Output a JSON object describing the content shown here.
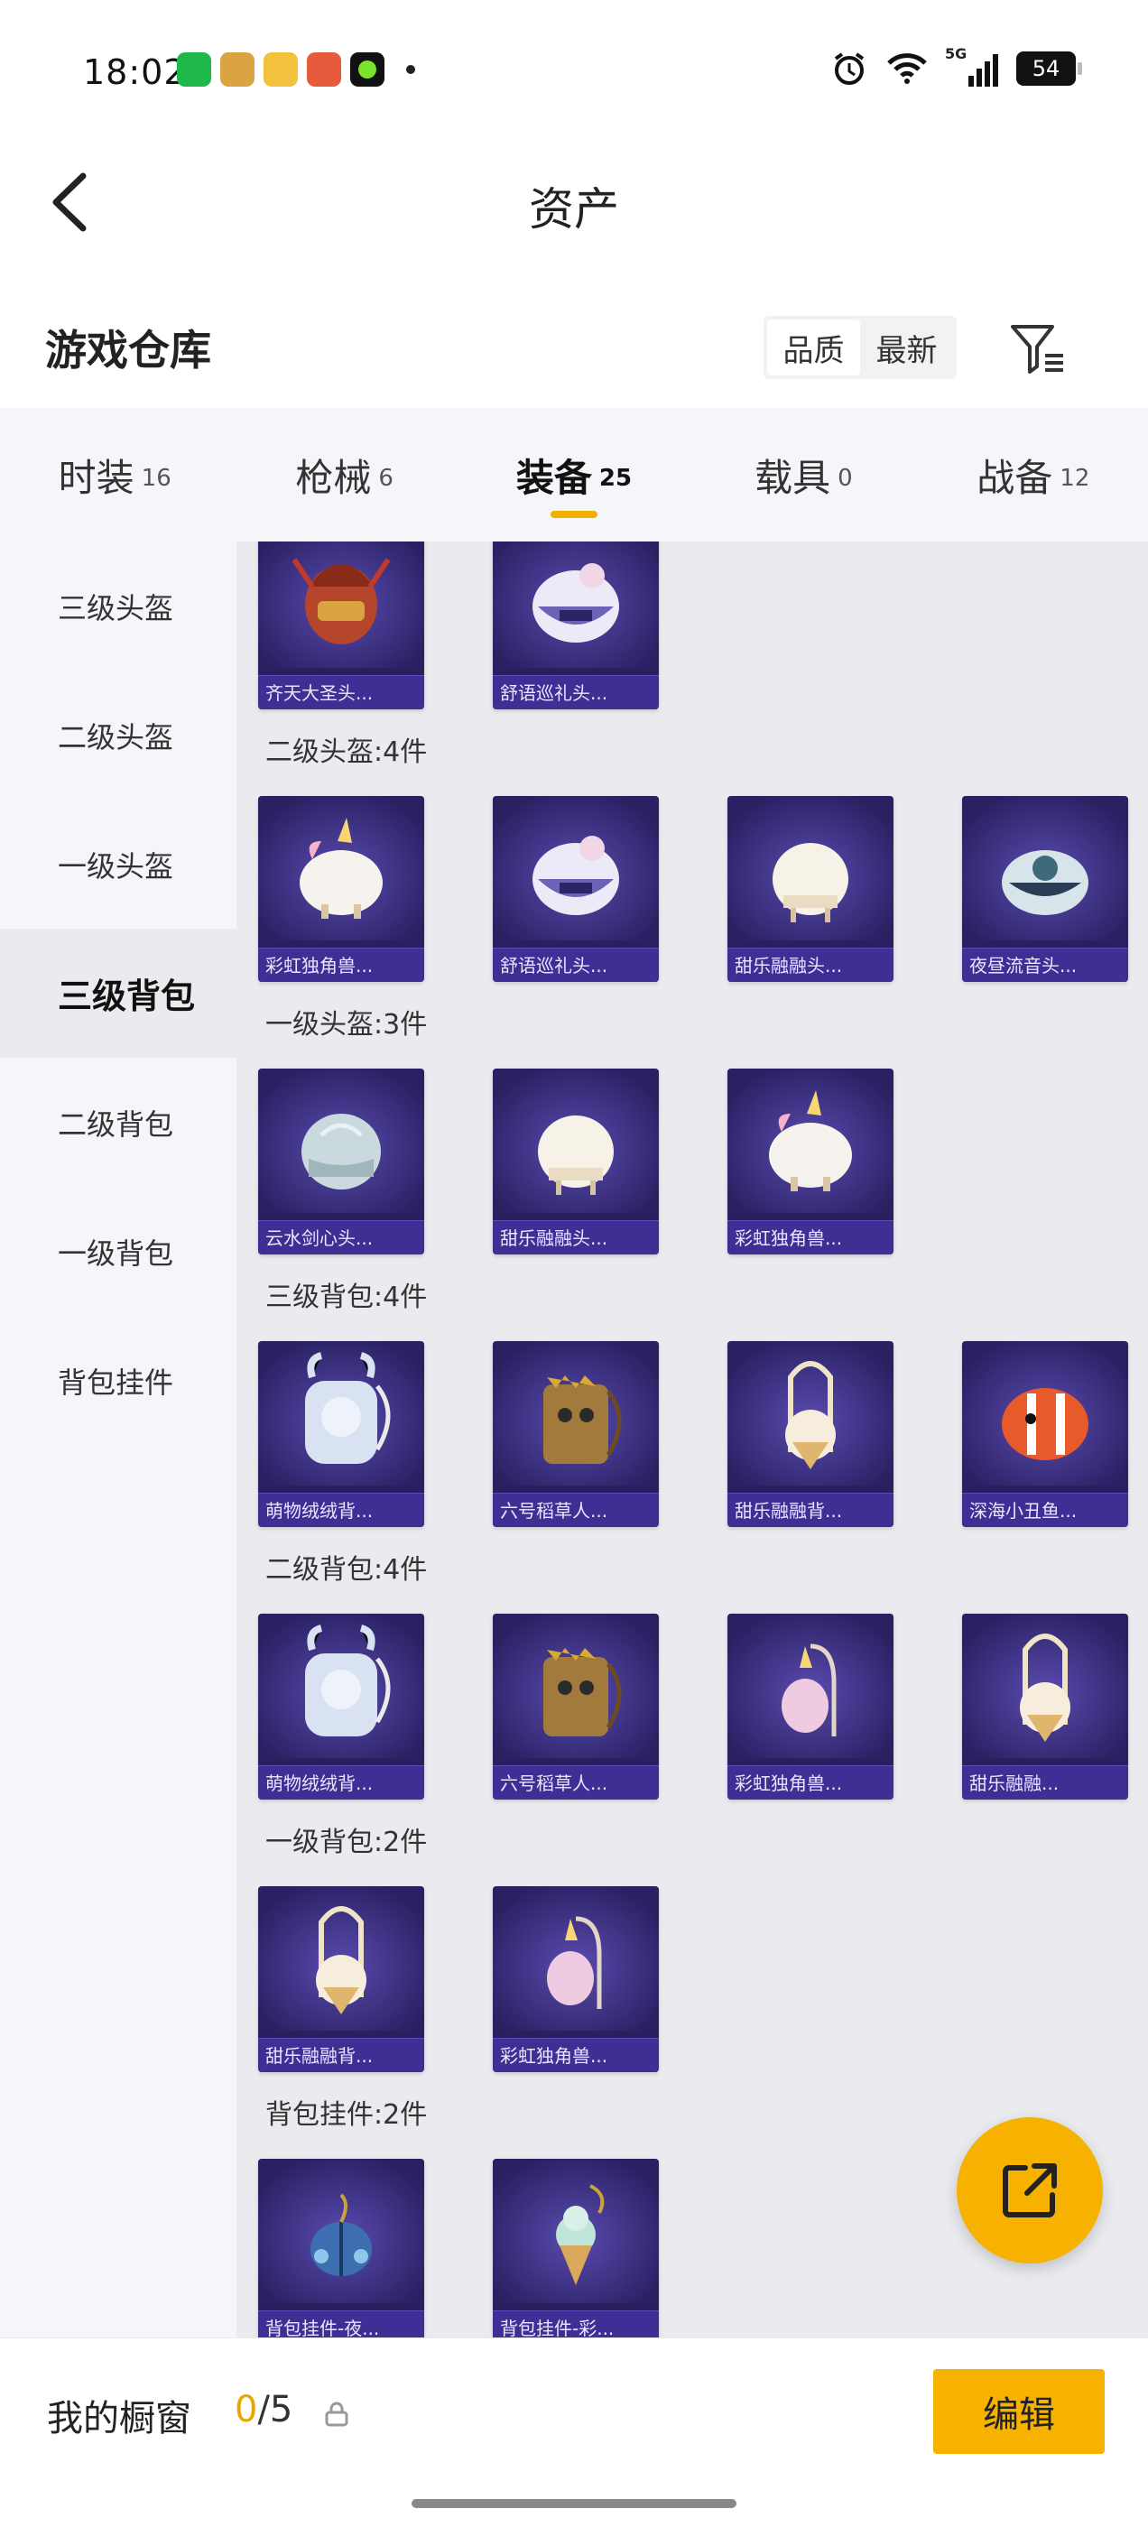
{
  "status_bar": {
    "time": "18:02",
    "app_colors": [
      "#1fb84a",
      "#d9a441",
      "#f2c23c",
      "#e55b3c",
      "#111111"
    ],
    "signal_text": "5G",
    "battery": "54"
  },
  "nav": {
    "title": "资产"
  },
  "section": {
    "title": "游戏仓库",
    "sort_options": [
      "品质",
      "最新"
    ],
    "active_sort": "品质"
  },
  "tabs": [
    {
      "label": "时装",
      "count": "16"
    },
    {
      "label": "枪械",
      "count": "6"
    },
    {
      "label": "装备",
      "count": "25"
    },
    {
      "label": "载具",
      "count": "0"
    },
    {
      "label": "战备",
      "count": "12"
    }
  ],
  "active_tab": "装备",
  "sidebar": [
    {
      "label": "三级头盔"
    },
    {
      "label": "二级头盔"
    },
    {
      "label": "一级头盔"
    },
    {
      "label": "三级背包"
    },
    {
      "label": "二级背包"
    },
    {
      "label": "一级背包"
    },
    {
      "label": "背包挂件"
    }
  ],
  "active_sidebar": "三级背包",
  "groups": [
    {
      "label": "",
      "items": [
        {
          "name": "齐天大圣头...",
          "icon": "helmet-monkey-king"
        },
        {
          "name": "舒语巡礼头...",
          "icon": "helmet-pilgrimage"
        }
      ]
    },
    {
      "label": "二级头盔:4件",
      "items": [
        {
          "name": "彩虹独角兽...",
          "icon": "helmet-unicorn"
        },
        {
          "name": "舒语巡礼头...",
          "icon": "helmet-pilgrimage"
        },
        {
          "name": "甜乐融融头...",
          "icon": "helmet-cream"
        },
        {
          "name": "夜昼流音头...",
          "icon": "helmet-night"
        }
      ]
    },
    {
      "label": "一级头盔:3件",
      "items": [
        {
          "name": "云水剑心头...",
          "icon": "helmet-cloud"
        },
        {
          "name": "甜乐融融头...",
          "icon": "helmet-cream"
        },
        {
          "name": "彩虹独角兽...",
          "icon": "helmet-unicorn"
        }
      ]
    },
    {
      "label": "三级背包:4件",
      "items": [
        {
          "name": "萌物绒绒背...",
          "icon": "backpack-plush"
        },
        {
          "name": "六号稻草人...",
          "icon": "backpack-scarecrow"
        },
        {
          "name": "甜乐融融背...",
          "icon": "backpack-icecream"
        },
        {
          "name": "深海小丑鱼...",
          "icon": "backpack-clownfish"
        }
      ]
    },
    {
      "label": "二级背包:4件",
      "items": [
        {
          "name": "萌物绒绒背...",
          "icon": "backpack-plush"
        },
        {
          "name": "六号稻草人...",
          "icon": "backpack-scarecrow"
        },
        {
          "name": "彩虹独角兽...",
          "icon": "backpack-unicorn"
        },
        {
          "name": "甜乐融融...",
          "icon": "backpack-icecream"
        }
      ]
    },
    {
      "label": "一级背包:2件",
      "items": [
        {
          "name": "甜乐融融背...",
          "icon": "backpack-icecream"
        },
        {
          "name": "彩虹独角兽...",
          "icon": "backpack-unicorn"
        }
      ]
    },
    {
      "label": "背包挂件:2件",
      "items": [
        {
          "name": "背包挂件-夜...",
          "icon": "charm-beetle"
        },
        {
          "name": "背包挂件-彩...",
          "icon": "charm-icecream"
        }
      ]
    }
  ],
  "bottom": {
    "showcase_label": "我的橱窗",
    "showcase_used": "0",
    "showcase_total": "/5",
    "edit_label": "编辑"
  },
  "colors": {
    "accent": "#f7b100",
    "card_bg": "#2d2466",
    "card_label_bg": "#3e2f95"
  }
}
